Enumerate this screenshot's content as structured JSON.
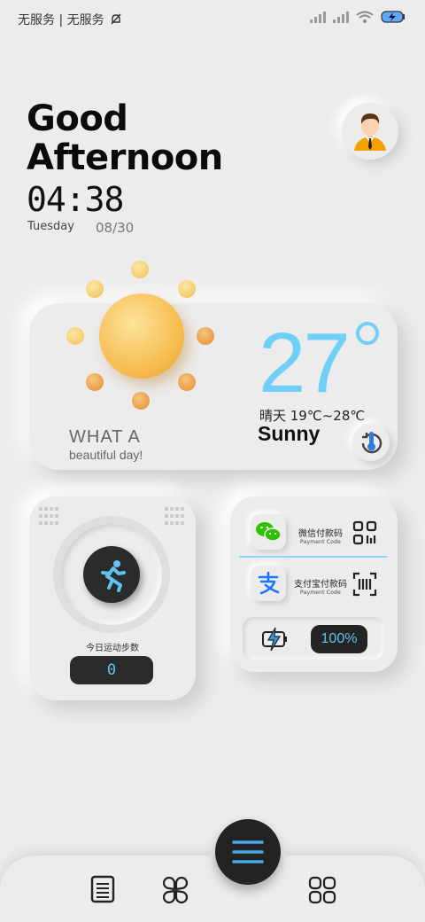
{
  "status_bar": {
    "carrier_text": "无服务 | 无服务",
    "icons": [
      "bell-off-icon",
      "signal-icon",
      "signal-icon",
      "wifi-icon",
      "battery-charging-icon"
    ]
  },
  "header": {
    "greeting_line1": "Good",
    "greeting_line2": "Afternoon",
    "time": "04:38",
    "weekday": "Tuesday",
    "date": "08/30",
    "avatar_icon": "businessman-avatar-icon"
  },
  "weather": {
    "temperature": "27",
    "range": "晴天 19℃~28℃",
    "condition": "Sunny",
    "tagline_line1": "WHAT A",
    "tagline_line2": "beautiful day!",
    "icon": "sun-icon",
    "refresh_icon": "thermometer-refresh-icon",
    "accent_color": "#6fcff6"
  },
  "steps": {
    "label": "今日运动步数",
    "count": "0",
    "icon": "running-man-icon"
  },
  "payments": {
    "wechat": {
      "name": "微信付款码",
      "subtitle": "Payment Code",
      "icon": "wechat-icon",
      "action_icon": "qr-code-icon"
    },
    "alipay": {
      "name": "支付宝付款码",
      "subtitle": "Payment Code",
      "icon": "alipay-icon",
      "action_icon": "barcode-scan-icon"
    },
    "battery_level": "100%",
    "battery_icon": "battery-charging-icon"
  },
  "dock": {
    "items": [
      "notes-icon",
      "clover-apps-icon",
      "menu-icon",
      "grid-apps-icon"
    ]
  }
}
